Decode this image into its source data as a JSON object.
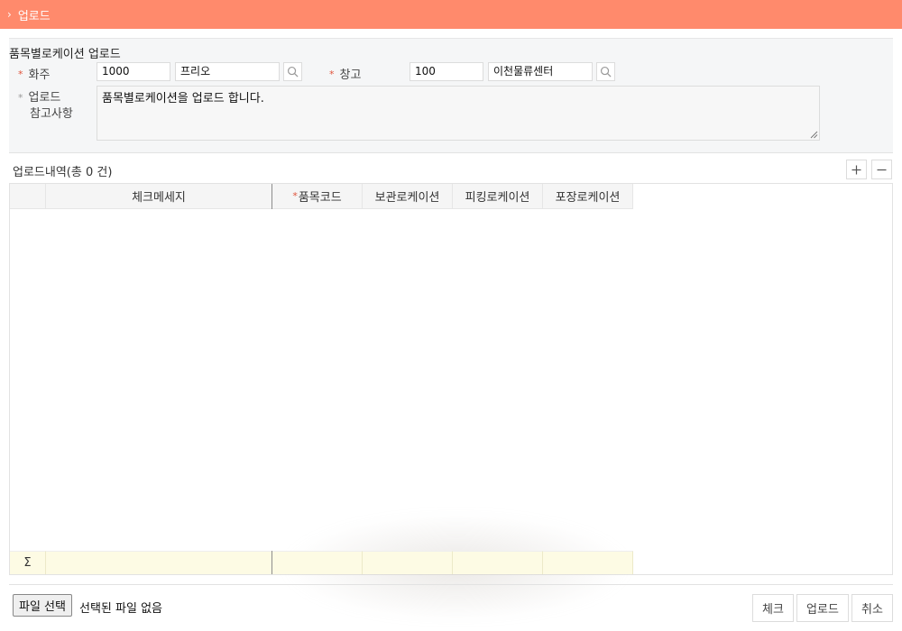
{
  "title": "업로드",
  "section_title": "품목별로케이션 업로드",
  "form": {
    "owner_label": "화주",
    "owner_code": "1000",
    "owner_name": "프리오",
    "warehouse_label": "창고",
    "warehouse_code": "100",
    "warehouse_name": "이천물류센터",
    "note_label_line1": "업로드",
    "note_label_line2": "참고사항",
    "note_text": "품목별로케이션을 업로드 합니다."
  },
  "list": {
    "title": "업로드내역(총 0 건)",
    "columns": [
      "체크메세지",
      "품목코드",
      "보관로케이션",
      "피킹로케이션",
      "포장로케이션"
    ],
    "required_marker": "*",
    "sum_symbol": "Σ"
  },
  "file": {
    "button_label": "파일 선택",
    "status_text": "선택된 파일 없음"
  },
  "actions": {
    "check": "체크",
    "upload": "업로드",
    "cancel": "취소"
  },
  "colors": {
    "header_bar": "#ff8a6c",
    "required": "#e0543c",
    "footer_row": "#fdfbe4"
  }
}
